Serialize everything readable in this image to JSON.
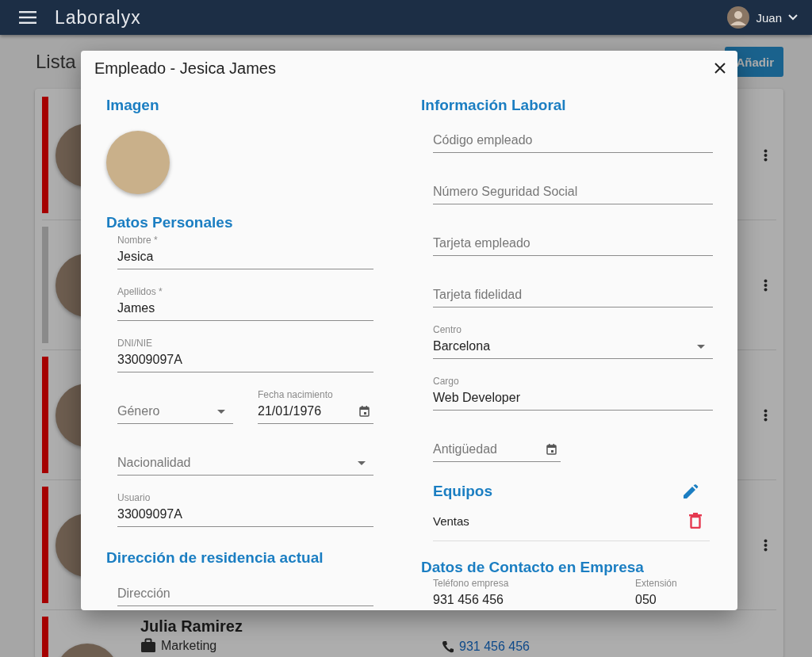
{
  "app_bar": {
    "title": "Laboralyx",
    "user_name": "Juan"
  },
  "page": {
    "title": "Lista",
    "add_button": "Añadir"
  },
  "employees": [
    {
      "color": "#a50000"
    },
    {
      "color": "#8a8a8a"
    },
    {
      "color": "#a50000"
    },
    {
      "color": "#a50000"
    },
    {
      "color": "#a50000",
      "name": "Julia Ramirez",
      "department": "Marketing",
      "phone": "931 456 456"
    }
  ],
  "dialog": {
    "title": "Empleado - Jesica James",
    "image_heading": "Imagen",
    "personal": {
      "heading": "Datos Personales",
      "rows": [
        [
          {
            "kind": "text",
            "label": "Nombre *",
            "value": "Jesica"
          }
        ],
        [
          {
            "kind": "text",
            "label": "Apellidos *",
            "value": "James"
          }
        ],
        [
          {
            "kind": "text",
            "label": "DNI/NIE",
            "value": "33009097A"
          }
        ],
        [
          {
            "kind": "select",
            "placeholder": "Género"
          },
          {
            "kind": "date",
            "label": "Fecha nacimiento",
            "value": "21/01/1976"
          }
        ],
        [
          {
            "kind": "select",
            "placeholder": "Nacionalidad"
          }
        ],
        [
          {
            "kind": "text",
            "label": "Usuario",
            "value": "33009097A"
          }
        ]
      ]
    },
    "address": {
      "heading": "Dirección de residencia actual",
      "rows": [
        [
          {
            "kind": "text",
            "placeholder": "Dirección"
          }
        ]
      ]
    },
    "work": {
      "heading": "Información Laboral",
      "rows": [
        [
          {
            "kind": "text",
            "placeholder": "Código empleado"
          }
        ],
        [
          {
            "kind": "text",
            "placeholder": "Número Seguridad Social"
          }
        ],
        [
          {
            "kind": "text",
            "placeholder": "Tarjeta empleado"
          }
        ],
        [
          {
            "kind": "text",
            "placeholder": "Tarjeta fidelidad"
          }
        ],
        [
          {
            "kind": "select",
            "label": "Centro",
            "value": "Barcelona"
          }
        ],
        [
          {
            "kind": "text",
            "label": "Cargo",
            "value": "Web Developer"
          }
        ],
        [
          {
            "kind": "date",
            "placeholder": "Antigüedad"
          }
        ]
      ]
    },
    "teams": {
      "heading": "Equipos",
      "items": [
        "Ventas"
      ]
    },
    "contact": {
      "heading": "Datos de Contacto en Empresa",
      "rows": [
        [
          {
            "kind": "text",
            "label": "Teléfono empresa",
            "value": "931 456 456"
          },
          {
            "kind": "text",
            "label": "Extensión",
            "value": "050"
          }
        ]
      ]
    }
  }
}
